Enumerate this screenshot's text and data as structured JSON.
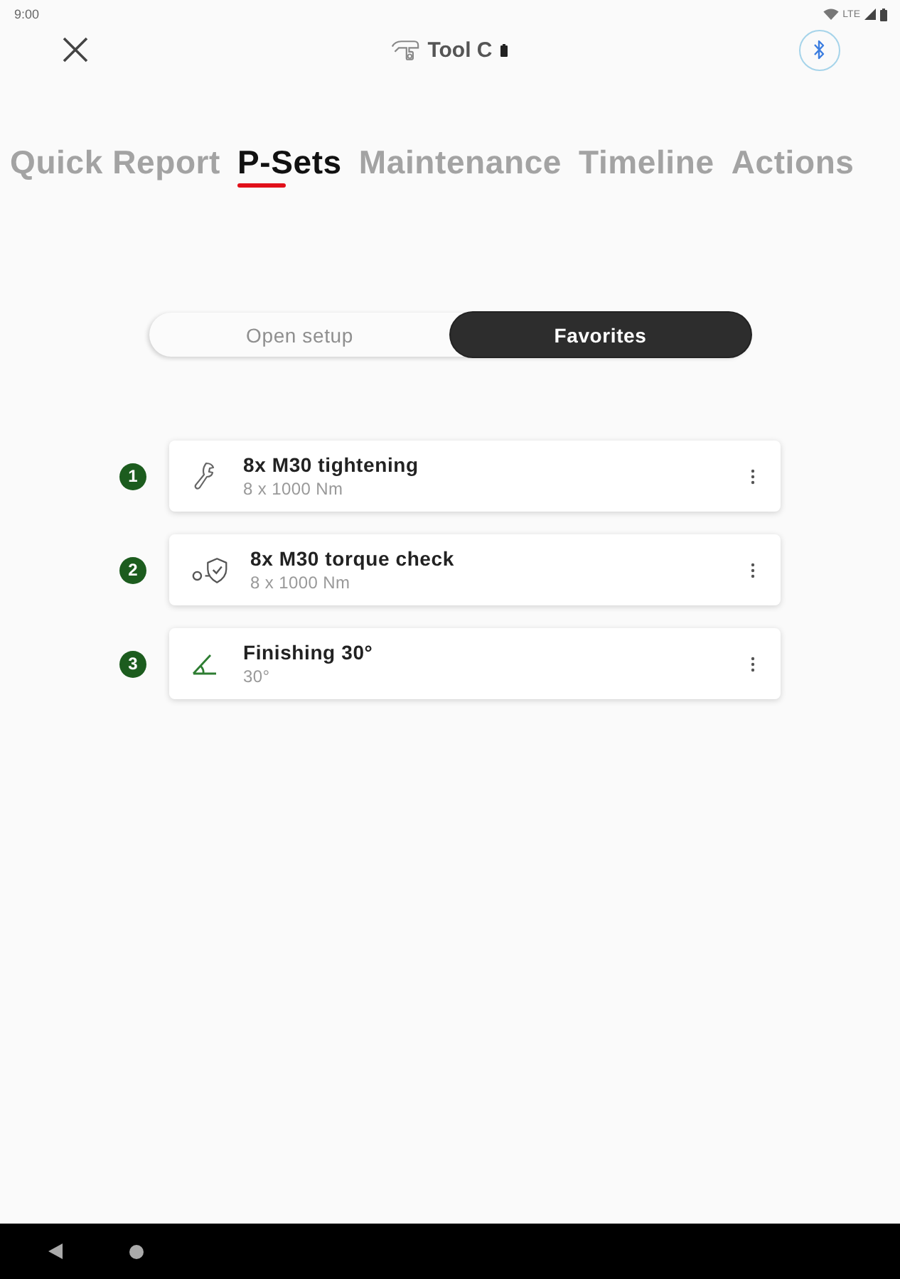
{
  "status_bar": {
    "time": "9:00",
    "network": "LTE"
  },
  "header": {
    "tool_name": "Tool C"
  },
  "tabs": [
    {
      "label": "Quick Report",
      "selected": false
    },
    {
      "label": "P-Sets",
      "selected": true
    },
    {
      "label": "Maintenance",
      "selected": false
    },
    {
      "label": "Timeline",
      "selected": false
    },
    {
      "label": "Actions",
      "selected": false
    }
  ],
  "segments": [
    {
      "label": "Open setup",
      "selected": false
    },
    {
      "label": "Favorites",
      "selected": true
    }
  ],
  "psets": [
    {
      "number": "1",
      "kind": "tightening",
      "title": "8x M30 tightening",
      "subtitle": "8 x 1000 Nm"
    },
    {
      "number": "2",
      "kind": "check",
      "title": "8x M30 torque check",
      "subtitle": "8 x 1000 Nm"
    },
    {
      "number": "3",
      "kind": "angle",
      "title": "Finishing 30°",
      "subtitle": "30°"
    }
  ]
}
